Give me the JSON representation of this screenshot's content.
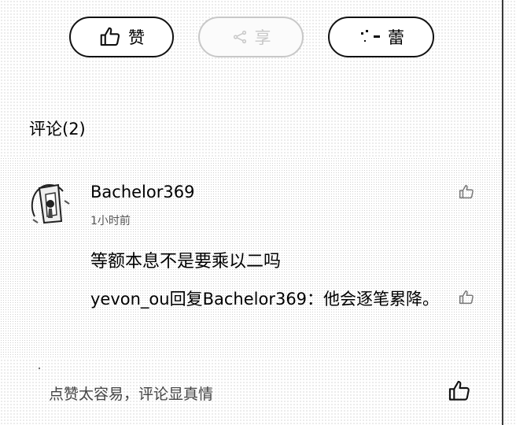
{
  "actions": {
    "like_label": "赞",
    "share_label": "享",
    "collect_label": "蕾"
  },
  "icons": {
    "like": "thumbs-up-icon",
    "share": "share-icon",
    "collect": "collect-icon"
  },
  "comments_section": {
    "title": "评论(2)"
  },
  "comment": {
    "username": "Bachelor369",
    "time": "1小时前",
    "text": "等额本息不是要乘以二吗",
    "reply": {
      "author": "yevon_ou",
      "verb": "回复",
      "target": "Bachelor369",
      "separator": "：",
      "text": "他会逐笔累降。"
    }
  },
  "bottom_bar": {
    "input_placeholder": "点赞太容易，评论显真情"
  }
}
